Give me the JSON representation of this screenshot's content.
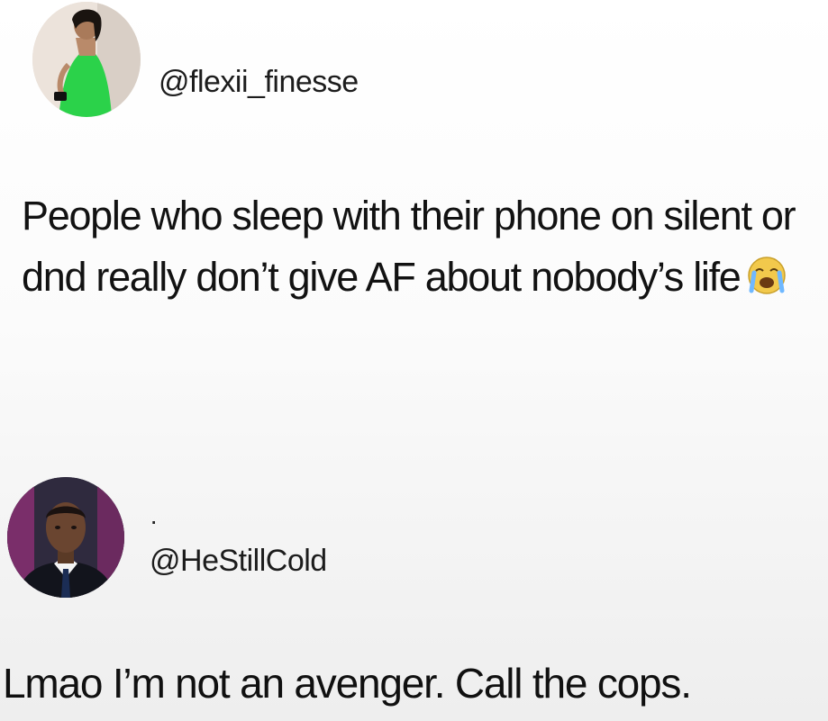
{
  "tweet": {
    "handle": "@flexii_finesse",
    "text": "People who sleep with their phone on silent or dnd really don’t give AF about nobody’s life",
    "emoji": "loudly-crying-face-icon"
  },
  "reply": {
    "separator": "·",
    "handle": "@HeStillCold",
    "text": "Lmao I’m not an avenger. Call the cops."
  },
  "colors": {
    "dress_green": "#2bd24a",
    "background": "#f4f4f4",
    "text": "#141414"
  }
}
